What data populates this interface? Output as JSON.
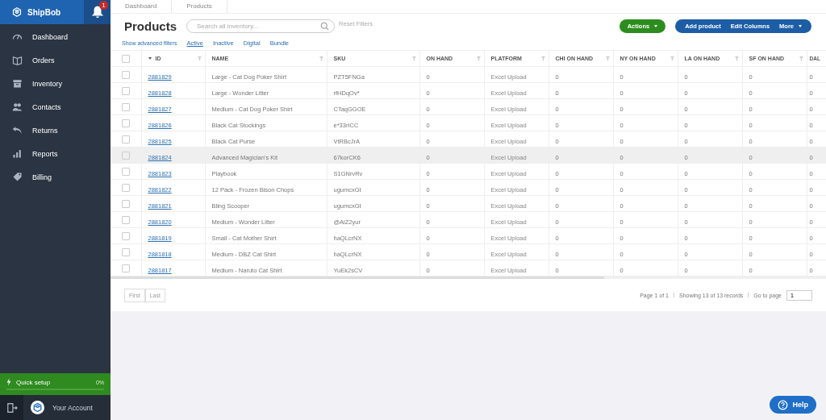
{
  "sidebar": {
    "brand": "ShipBob",
    "notifications": {
      "count": "1"
    },
    "items": [
      {
        "label": "Dashboard",
        "selected": false
      },
      {
        "label": "Orders",
        "selected": false
      },
      {
        "label": "Inventory",
        "selected": false
      },
      {
        "label": "Contacts",
        "selected": false
      },
      {
        "label": "Returns",
        "selected": false
      },
      {
        "label": "Reports",
        "selected": false
      },
      {
        "label": "Billing",
        "selected": false
      }
    ],
    "quick_setup": {
      "label": "Quick setup",
      "reading": "0%",
      "level": 0
    },
    "account": {
      "label": "Your Account"
    }
  },
  "breadcrumbs": [
    "Dashboard",
    "Products"
  ],
  "page_title": "Products",
  "search": {
    "placeholder": "Search all inventory..."
  },
  "reset_filters": "Reset Filters",
  "actions_button": "Actions",
  "toolbar_buttons": [
    "Add product",
    "Edit Columns",
    "More"
  ],
  "advanced_filters_link": "Show advanced filters",
  "filter_tabs": [
    {
      "label": "Active",
      "selected": true
    },
    {
      "label": "Inactive",
      "selected": false
    },
    {
      "label": "Digital",
      "selected": false
    },
    {
      "label": "Bundle",
      "selected": false
    }
  ],
  "table": {
    "select_all_checked": false,
    "columns": [
      {
        "label": "ID",
        "sorted": true,
        "filter": true
      },
      {
        "label": "NAME",
        "sorted": false,
        "filter": true
      },
      {
        "label": "SKU",
        "sorted": false,
        "filter": true
      },
      {
        "label": "ON HAND",
        "sorted": false,
        "filter": true
      },
      {
        "label": "PLATFORM",
        "sorted": false,
        "filter": true
      },
      {
        "label": "CHI ON HAND",
        "sorted": false,
        "filter": true
      },
      {
        "label": "NY ON HAND",
        "sorted": false,
        "filter": true
      },
      {
        "label": "LA ON HAND",
        "sorted": false,
        "filter": true
      },
      {
        "label": "SF ON HAND",
        "sorted": false,
        "filter": true
      },
      {
        "label": "DAL",
        "sorted": false,
        "filter": false
      }
    ],
    "rows": [
      {
        "checked": false,
        "highlighted": false,
        "cells": [
          "2881829",
          "Large - Cat Dog Poker Shirt",
          "PZT5FNGa",
          "0",
          "Excel Upload",
          "0",
          "0",
          "0",
          "0",
          "0"
        ]
      },
      {
        "checked": false,
        "highlighted": false,
        "cells": [
          "2881828",
          "Large - Wonder Litter",
          "rfHDqOv*",
          "0",
          "Excel Upload",
          "0",
          "0",
          "0",
          "0",
          "0"
        ]
      },
      {
        "checked": false,
        "highlighted": false,
        "cells": [
          "2881827",
          "Medium - Cat Dog Poker Shirt",
          "CTaqGGOE",
          "0",
          "Excel Upload",
          "0",
          "0",
          "0",
          "0",
          "0"
        ]
      },
      {
        "checked": false,
        "highlighted": false,
        "cells": [
          "2881826",
          "Black Cat Stockings",
          "e*33rICC",
          "0",
          "Excel Upload",
          "0",
          "0",
          "0",
          "0",
          "0"
        ]
      },
      {
        "checked": false,
        "highlighted": false,
        "cells": [
          "2881825",
          "Black Cat Purse",
          "VtRBcJrA",
          "0",
          "Excel Upload",
          "0",
          "0",
          "0",
          "0",
          "0"
        ]
      },
      {
        "checked": false,
        "highlighted": true,
        "cells": [
          "2881824",
          "Advanced Magician's Kit",
          "67korCK6",
          "0",
          "Excel Upload",
          "0",
          "0",
          "0",
          "0",
          "0"
        ]
      },
      {
        "checked": false,
        "highlighted": false,
        "cells": [
          "2881823",
          "Playbook",
          "S1GNrvRv",
          "0",
          "Excel Upload",
          "0",
          "0",
          "0",
          "0",
          "0"
        ]
      },
      {
        "checked": false,
        "highlighted": false,
        "cells": [
          "2881822",
          "12 Pack - Frozen Bison Chops",
          "ugumcxGt",
          "0",
          "Excel Upload",
          "0",
          "0",
          "0",
          "0",
          "0"
        ]
      },
      {
        "checked": false,
        "highlighted": false,
        "cells": [
          "2881821",
          "Bling Scooper",
          "ugumcxGt",
          "0",
          "Excel Upload",
          "0",
          "0",
          "0",
          "0",
          "0"
        ]
      },
      {
        "checked": false,
        "highlighted": false,
        "cells": [
          "2881820",
          "Medium - Wonder Litter",
          "@AiZ2yur",
          "0",
          "Excel Upload",
          "0",
          "0",
          "0",
          "0",
          "0"
        ]
      },
      {
        "checked": false,
        "highlighted": false,
        "cells": [
          "2881819",
          "Small - Cat Mother Shirt",
          "haQLcrNX",
          "0",
          "Excel Upload",
          "0",
          "0",
          "0",
          "0",
          "0"
        ]
      },
      {
        "checked": false,
        "highlighted": false,
        "cells": [
          "2881818",
          "Medium - DBZ Cat Shirt",
          "haQLcrNX",
          "0",
          "Excel Upload",
          "0",
          "0",
          "0",
          "0",
          "0"
        ]
      },
      {
        "checked": false,
        "highlighted": false,
        "cells": [
          "2881817",
          "Medium - Naruto Cat Shirt",
          "YuEk2sCV",
          "0",
          "Excel Upload",
          "0",
          "0",
          "0",
          "0",
          "0"
        ]
      }
    ]
  },
  "pagination": {
    "buttons": [
      "First",
      "Last"
    ],
    "page_info": "Page 1 of 1",
    "records": "Showing 13 of 13 records",
    "go_to_label": "Go to page",
    "page_value": "1"
  },
  "help_button": "Help"
}
